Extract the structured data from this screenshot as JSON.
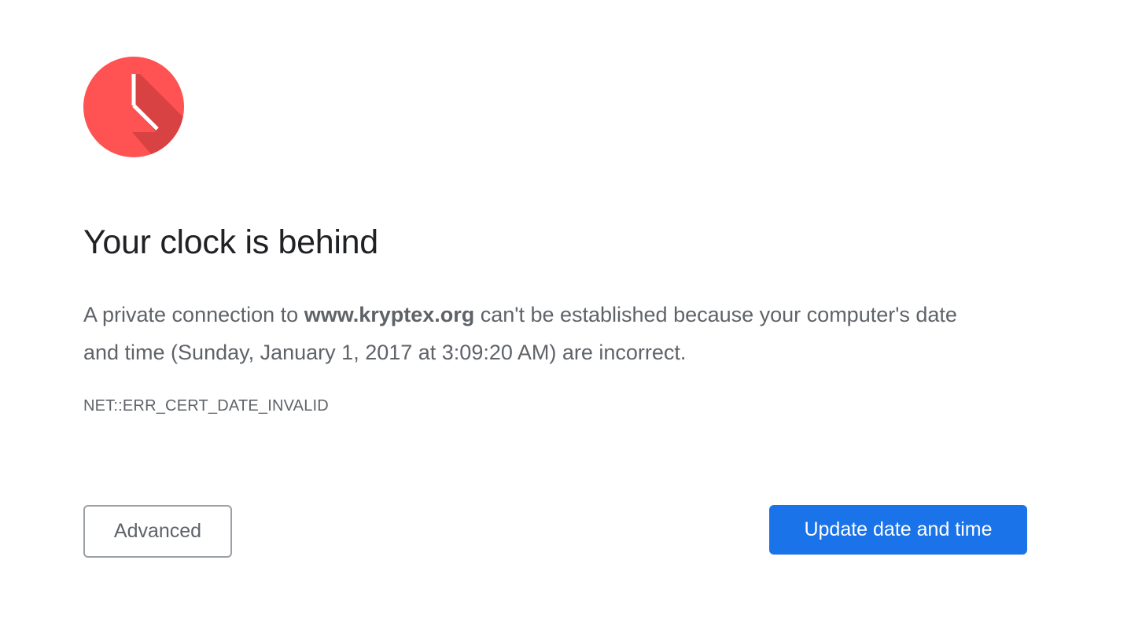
{
  "icon": {
    "name": "clock-icon",
    "color": "#ff5252",
    "shadow_color": "#d23f3f",
    "hand_color": "#ffffff"
  },
  "heading": "Your clock is behind",
  "message": {
    "prefix": "A private connection to ",
    "domain": "www.kryptex.org",
    "suffix": " can't be established because your computer's date and time (Sunday, January 1, 2017 at 3:09:20 AM) are incorrect."
  },
  "error_code": "NET::ERR_CERT_DATE_INVALID",
  "buttons": {
    "advanced_label": "Advanced",
    "update_label": "Update date and time"
  },
  "colors": {
    "primary": "#1a73e8",
    "heading": "#202124",
    "body_text": "#5f6368"
  }
}
